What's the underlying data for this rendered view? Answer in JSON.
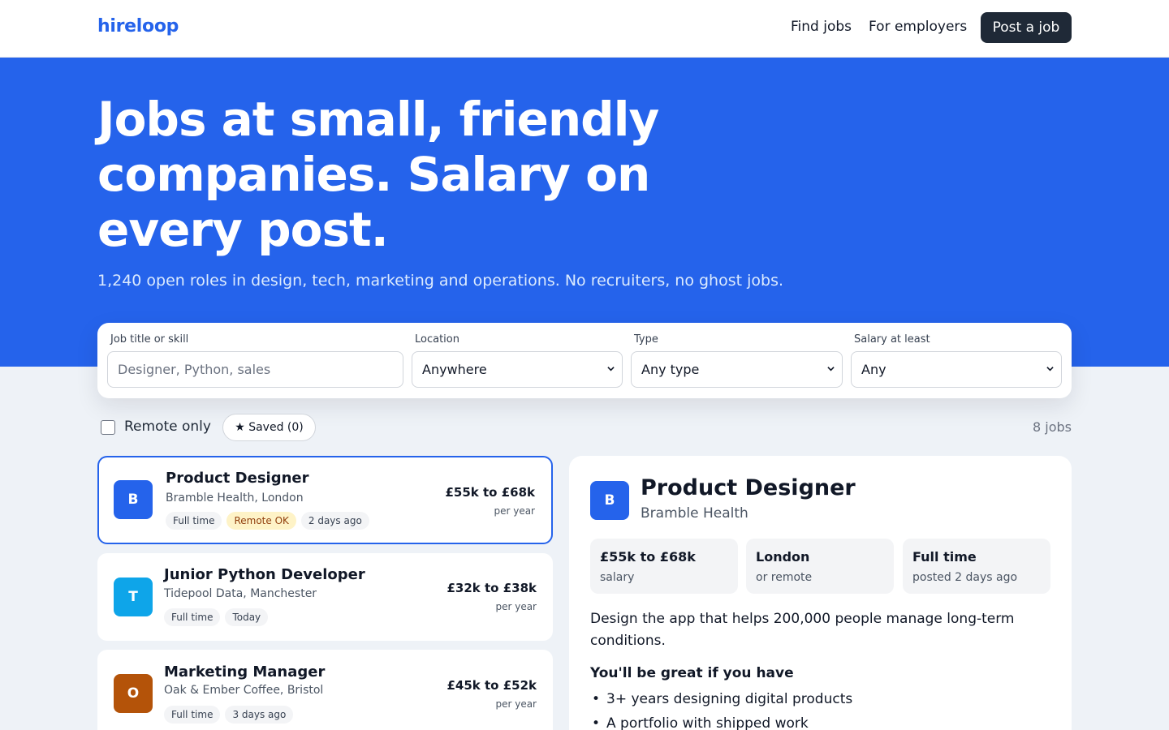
{
  "nav": {
    "logo": "hireloop",
    "links": [
      "Find jobs",
      "For employers"
    ],
    "cta": "Post a job"
  },
  "hero": {
    "title": "Jobs at small, friendly companies. Salary on every post.",
    "subtitle": "1,240 open roles in design, tech, marketing and operations. No recruiters, no ghost jobs."
  },
  "search": {
    "job": {
      "label": "Job title or skill",
      "placeholder": "Designer, Python, sales"
    },
    "location": {
      "label": "Location",
      "value": "Anywhere"
    },
    "type": {
      "label": "Type",
      "value": "Any type"
    },
    "salary": {
      "label": "Salary at least",
      "value": "Any"
    }
  },
  "filters": {
    "remote_label": "Remote only",
    "remote_checked": false,
    "saved_label": "★ Saved (0)",
    "count": "8 jobs"
  },
  "jobs": [
    {
      "initial": "B",
      "color": "#2563eb",
      "title": "Product Designer",
      "company": "Bramble Health, London",
      "tags": [
        "Full time",
        "Remote OK",
        "2 days ago"
      ],
      "salary": "£55k to £68k",
      "period": "per year",
      "selected": true
    },
    {
      "initial": "T",
      "color": "#0ea5e9",
      "title": "Junior Python Developer",
      "company": "Tidepool Data, Manchester",
      "tags": [
        "Full time",
        "Today"
      ],
      "salary": "£32k to £38k",
      "period": "per year",
      "selected": false
    },
    {
      "initial": "O",
      "color": "#b45309",
      "title": "Marketing Manager",
      "company": "Oak & Ember Coffee, Bristol",
      "tags": [
        "Full time",
        "3 days ago"
      ],
      "salary": "£45k to £52k",
      "period": "per year",
      "selected": false
    }
  ],
  "detail": {
    "initial": "B",
    "title": "Product Designer",
    "company": "Bramble Health",
    "stats": [
      {
        "main": "£55k to £68k",
        "sub": "salary"
      },
      {
        "main": "London",
        "sub": "or remote"
      },
      {
        "main": "Full time",
        "sub": "posted 2 days ago"
      }
    ],
    "description": "Design the app that helps 200,000 people manage long-term conditions.",
    "section_title": "You'll be great if you have",
    "requirements": [
      "3+ years designing digital products",
      "A portfolio with shipped work"
    ]
  }
}
